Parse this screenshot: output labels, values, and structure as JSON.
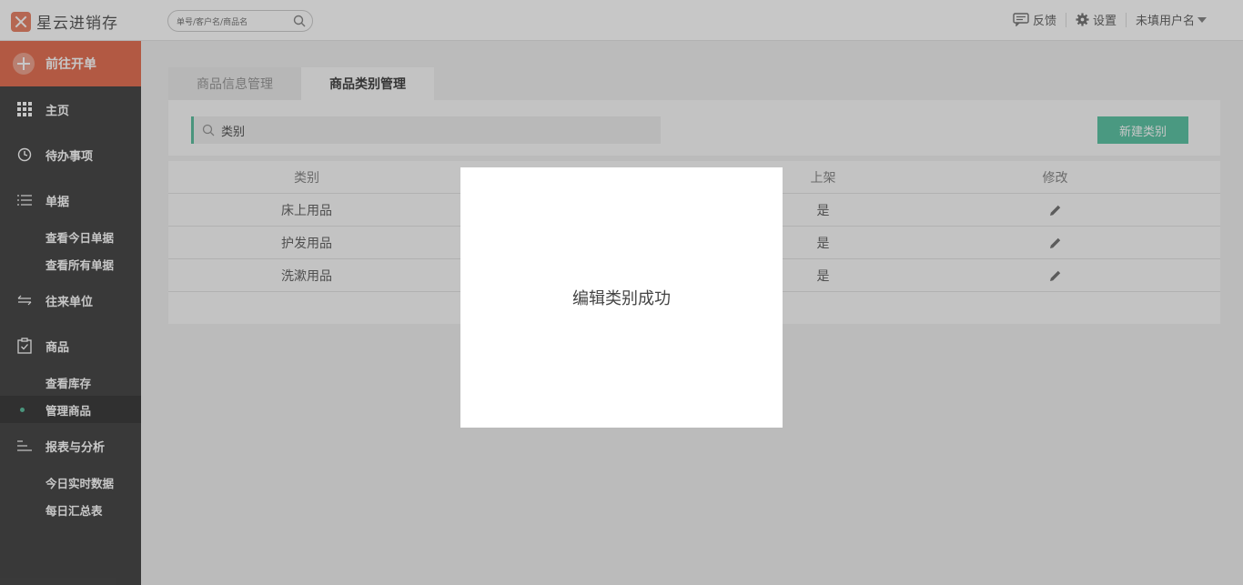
{
  "app": {
    "name": "星云进销存"
  },
  "top_search": {
    "placeholder": "单号/客户名/商品名"
  },
  "top_right": {
    "feedback": "反馈",
    "settings": "设置",
    "user": "未填用户名"
  },
  "sidebar": {
    "go_order": "前往开单",
    "home": "主页",
    "todo": "待办事项",
    "bills": "单据",
    "bills_today": "查看今日单据",
    "bills_all": "查看所有单据",
    "partners": "往来单位",
    "goods": "商品",
    "goods_stock": "查看库存",
    "goods_manage": "管理商品",
    "reports": "报表与分析",
    "reports_today": "今日实时数据",
    "reports_daily": "每日汇总表"
  },
  "tabs": {
    "info": "商品信息管理",
    "category": "商品类别管理"
  },
  "filter": {
    "value": "类别"
  },
  "new_button": "新建类别",
  "table": {
    "headers": {
      "category": "类别",
      "shelf": "上架",
      "edit": "修改"
    },
    "rows": [
      {
        "category": "床上用品",
        "shelf": "是"
      },
      {
        "category": "护发用品",
        "shelf": "是"
      },
      {
        "category": "洗漱用品",
        "shelf": "是"
      }
    ]
  },
  "modal": {
    "message": "编辑类别成功"
  },
  "colors": {
    "accent": "#5fc4a6",
    "brand": "#e57356",
    "sidebar": "#4a4a4a"
  }
}
